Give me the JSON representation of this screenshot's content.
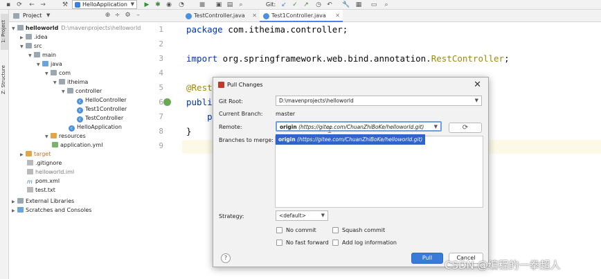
{
  "toolbar": {
    "run_config": "HelloApplication",
    "git_label": "Git:"
  },
  "left_stripe": {
    "project_tab": "1: Project",
    "structure_tab": "Z: Structure"
  },
  "project_panel": {
    "title": "Project",
    "tree": [
      {
        "label": "helloworld",
        "path": "D:\\mavenprojects\\helloworld",
        "icon": "folder-icon"
      },
      {
        "label": ".idea",
        "icon": "folder-icon"
      },
      {
        "label": "src",
        "icon": "folder-icon"
      },
      {
        "label": "main",
        "icon": "folder-icon"
      },
      {
        "label": "java",
        "icon": "folder-icon"
      },
      {
        "label": "com",
        "icon": "package-icon"
      },
      {
        "label": "itheima",
        "icon": "package-icon"
      },
      {
        "label": "controller",
        "icon": "package-icon"
      },
      {
        "label": "HelloController",
        "icon": "class-icon"
      },
      {
        "label": "Test1Controller",
        "icon": "class-icon"
      },
      {
        "label": "TestController",
        "icon": "class-icon"
      },
      {
        "label": "HelloApplication",
        "icon": "spring-class-icon"
      },
      {
        "label": "resources",
        "icon": "folder-icon"
      },
      {
        "label": "application.yml",
        "icon": "yml-file-icon"
      },
      {
        "label": "target",
        "icon": "folder-icon"
      },
      {
        "label": ".gitignore",
        "icon": "file-icon"
      },
      {
        "label": "helloworld.iml",
        "icon": "iml-file-icon"
      },
      {
        "label": "pom.xml",
        "icon": "maven-file-icon"
      },
      {
        "label": "test.txt",
        "icon": "text-file-icon"
      },
      {
        "label": "External Libraries",
        "icon": "library-icon"
      },
      {
        "label": "Scratches and Consoles",
        "icon": "scratches-icon"
      }
    ]
  },
  "editor": {
    "tabs": [
      {
        "label": "TestController.java",
        "active": false
      },
      {
        "label": "Test1Controller.java",
        "active": true
      }
    ],
    "line_numbers": [
      "1",
      "2",
      "3",
      "4",
      "5",
      "6",
      "7",
      "8",
      "9"
    ],
    "code": {
      "line1_kw": "package",
      "line1_rest": " com.itheima.controller;",
      "line3_kw": "import",
      "line3_rest": " org.springframework.web.bind.annotation.",
      "line3_cls": "RestController",
      "line3_end": ";",
      "line5": "@Rest",
      "line6": "publi",
      "line7": "    p",
      "line8": "}"
    }
  },
  "dialog": {
    "title": "Pull Changes",
    "close_glyph": "✕",
    "git_root_label": "Git Root:",
    "git_root_value": "D:\\mavenprojects\\helloworld",
    "current_branch_label": "Current Branch:",
    "current_branch_value": "master",
    "remote_label": "Remote:",
    "remote_name": "origin",
    "remote_url": "(https://gitee.com/ChuanZhiBoKe/helloworld.git)",
    "remote_popup_name": "origin",
    "remote_popup_url": "(https://gitee.com/ChuanZhiBoKe/helloworld.git)",
    "branches_label": "Branches to merge:",
    "strategy_label": "Strategy:",
    "strategy_value": "<default>",
    "options": {
      "no_commit": "No commit",
      "squash_commit": "Squash commit",
      "no_fast_forward": "No fast forward",
      "add_log": "Add log information"
    },
    "help_label": "?",
    "pull_label": "Pull",
    "cancel_label": "Cancel"
  },
  "watermark": "CSDN @编程的一拳超人",
  "colors": {
    "accent": "#3a7ad9",
    "keyword": "#0033b3",
    "annotation": "#9e880d",
    "selection": "#2f65ca"
  }
}
